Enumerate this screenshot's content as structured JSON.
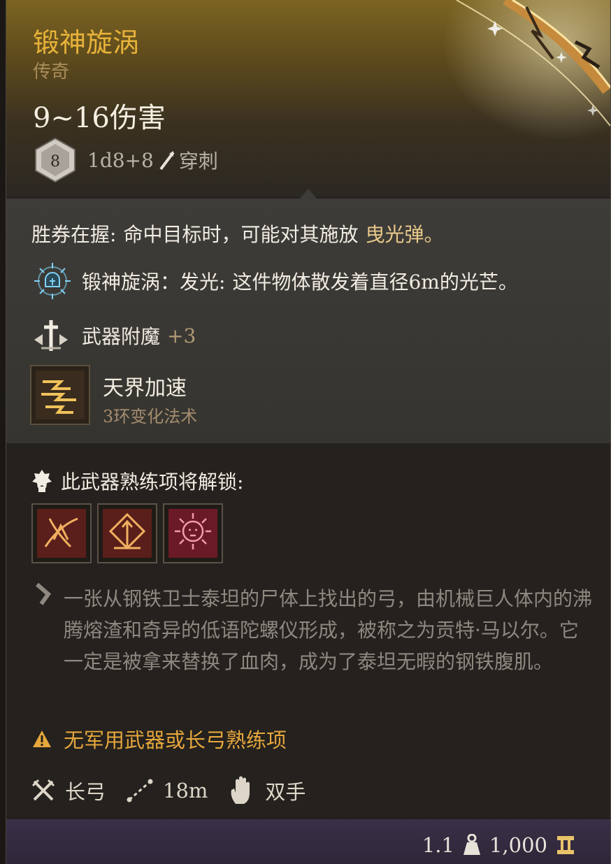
{
  "item": {
    "name": "锻神旋涡",
    "rarity": "传奇",
    "damage": "9~16伤害",
    "dice_value": "8",
    "damage_roll": "1d8+8",
    "damage_type": "穿刺"
  },
  "effects": {
    "passive_name": "胜券在握:",
    "passive_text": "命中目标时，可能对其施放",
    "passive_link": "曳光弹。",
    "glow_name": "锻神旋涡：",
    "glow_label": "发光:",
    "glow_text": "这件物体散发着直径6m的光芒。",
    "enchant_label": "武器附魔",
    "enchant_value": "+3",
    "spell_name": "天界加速",
    "spell_level": "3环变化法术"
  },
  "proficiency": {
    "header": "此武器熟练项将解锁:",
    "action_icons": [
      "bow-stance-icon",
      "arrow-frame-icon",
      "skull-burst-icon"
    ]
  },
  "description": "一张从钢铁卫士泰坦的尸体上找出的弓，由机械巨人体内的沸腾熔渣和奇异的低语陀螺仪形成，被称之为贡特·马以尔。它一定是被拿来替换了血肉，成为了泰坦无暇的钢铁腹肌。",
  "warning": "无军用武器或长弓熟练项",
  "properties": {
    "weapon_type": "长弓",
    "range": "18m",
    "handedness": "双手"
  },
  "footer": {
    "weight": "1.1",
    "value": "1,000"
  },
  "colors": {
    "legendary": "#e8b23a",
    "warning": "#e5a63c",
    "footer_bg": "#3a3048"
  }
}
